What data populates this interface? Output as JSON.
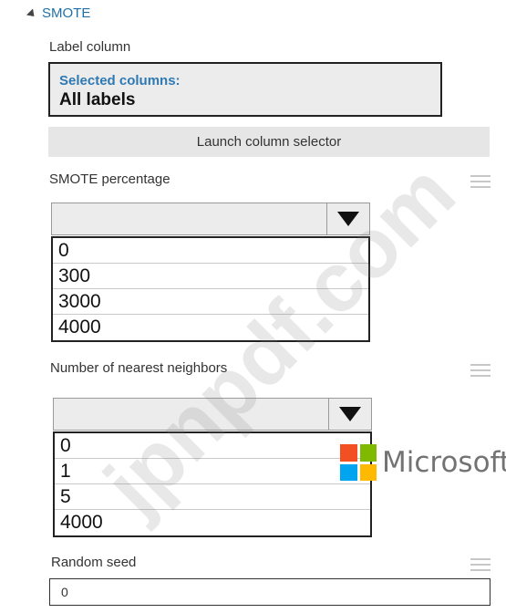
{
  "section": {
    "title": "SMOTE"
  },
  "label_column": {
    "label": "Label column",
    "selected_title": "Selected columns:",
    "selected_value": "All labels",
    "launch_button": "Launch column selector"
  },
  "smote_percentage": {
    "label": "SMOTE percentage",
    "value": "",
    "options": [
      "0",
      "300",
      "3000",
      "4000"
    ]
  },
  "nearest_neighbors": {
    "label": "Number of nearest neighbors",
    "value": "",
    "options": [
      "0",
      "1",
      "5",
      "4000"
    ]
  },
  "random_seed": {
    "label": "Random seed",
    "value": "0"
  },
  "watermark": "jpnpdf.com",
  "brand": {
    "name": "Microsoft",
    "colors": [
      "#f25022",
      "#7fba00",
      "#00a4ef",
      "#ffb900"
    ]
  }
}
